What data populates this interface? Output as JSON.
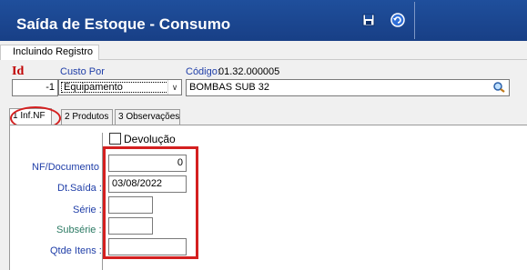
{
  "window": {
    "title": "Saída de Estoque - Consumo",
    "buttons": [
      {
        "name": "save",
        "icon": "floppy-disk-icon"
      },
      {
        "name": "undo",
        "icon": "undo-arrow-icon"
      }
    ]
  },
  "status": {
    "tab_label": "Incluindo Registro"
  },
  "header": {
    "id_label": "Id",
    "id_value": "-1",
    "custo_label": "Custo Por",
    "custo_value": "Equipamento",
    "codigo_label": "Código:",
    "codigo_value": "01.32.000005",
    "codigo_desc": "BOMBAS SUB 32"
  },
  "tabs": [
    {
      "label": "1 Inf.NF",
      "active": true
    },
    {
      "label": "2 Produtos",
      "active": false
    },
    {
      "label": "3 Observações",
      "active": false
    }
  ],
  "form": {
    "devolucao_label": "Devolução",
    "devolucao_checked": false,
    "nf_label": "NF/Documento :",
    "nf_value": "0",
    "dtsaida_label": "Dt.Saída :",
    "dtsaida_value": "03/08/2022",
    "serie_label": "Série :",
    "serie_value": "",
    "subserie_label": "Subsérie :",
    "subserie_value": "",
    "qtde_label": "Qtde Itens :",
    "qtde_value": ""
  },
  "colors": {
    "titlebar": "#1f4f9c",
    "highlight": "#d42020",
    "label_blue": "#1f3ea8",
    "label_red": "#c00000"
  }
}
